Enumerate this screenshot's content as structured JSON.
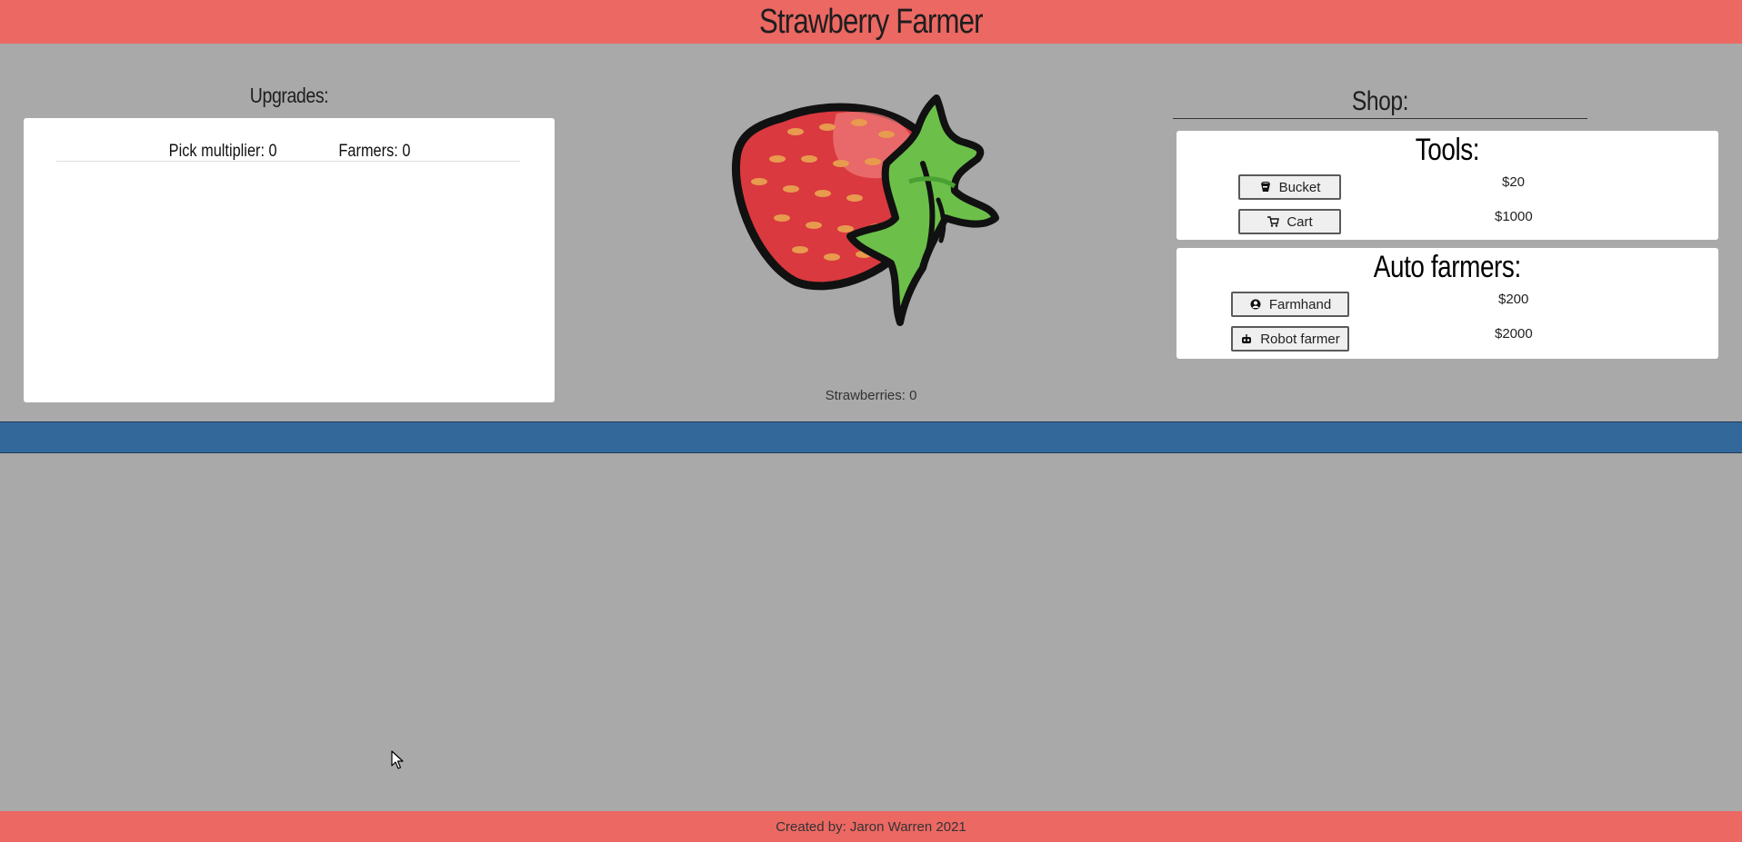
{
  "header": {
    "title": "Strawberry Farmer"
  },
  "upgrades": {
    "heading": "Upgrades:",
    "pick_multiplier": "Pick multiplier: 0",
    "farmers": "Farmers: 0"
  },
  "strawberry": {
    "count_label": "Strawberries: 0"
  },
  "shop": {
    "heading": "Shop:",
    "tools": {
      "title": "Tools:",
      "items": [
        {
          "label": "Bucket",
          "price": "$20",
          "icon": "bucket-icon"
        },
        {
          "label": "Cart",
          "price": "$1000",
          "icon": "cart-icon"
        }
      ]
    },
    "auto_farmers": {
      "title": "Auto farmers:",
      "items": [
        {
          "label": "Farmhand",
          "price": "$200",
          "icon": "person-icon"
        },
        {
          "label": "Robot farmer",
          "price": "$2000",
          "icon": "robot-icon"
        }
      ]
    }
  },
  "footer": {
    "credit": "Created by: Jaron Warren 2021"
  },
  "colors": {
    "header_bg": "#ec6863",
    "page_bg": "#a9a9a9",
    "divider_bar": "#33689a",
    "panel_bg": "#ffffff"
  }
}
